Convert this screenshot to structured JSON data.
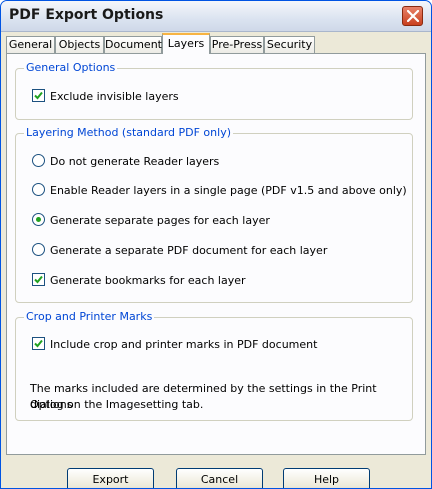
{
  "window": {
    "title": "PDF Export Options"
  },
  "tabs": [
    {
      "label": "General"
    },
    {
      "label": "Objects"
    },
    {
      "label": "Document"
    },
    {
      "label": "Layers"
    },
    {
      "label": "Pre-Press"
    },
    {
      "label": "Security"
    }
  ],
  "active_tab": "Layers",
  "general_options": {
    "title": "General Options",
    "exclude_invisible": {
      "label": "Exclude invisible layers",
      "checked": true
    }
  },
  "layering_method": {
    "title": "Layering Method (standard PDF only)",
    "options": [
      {
        "label": "Do not generate Reader layers",
        "selected": false
      },
      {
        "label": "Enable Reader layers in a single page (PDF v1.5 and above only)",
        "selected": false
      },
      {
        "label": "Generate separate pages for each layer",
        "selected": true
      },
      {
        "label": "Generate a separate PDF document for each layer",
        "selected": false
      }
    ],
    "bookmarks": {
      "label": "Generate bookmarks for each layer",
      "checked": true
    }
  },
  "crop_marks": {
    "title": "Crop and Printer Marks",
    "include": {
      "label": "Include crop and printer marks in PDF document",
      "checked": true
    },
    "note_line1": "The marks included are determined by the settings in the Print Options",
    "note_line2": "dialog on the Imagesetting tab."
  },
  "buttons": {
    "export": "Export",
    "cancel": "Cancel",
    "help": "Help"
  },
  "colors": {
    "accent_text": "#0046d5",
    "active_tab_top": "#f7b342",
    "radio_dot": "#21a121",
    "close_button": "#c9401f"
  },
  "icons": {
    "close": "close-x-icon",
    "check": "checkmark-icon"
  }
}
